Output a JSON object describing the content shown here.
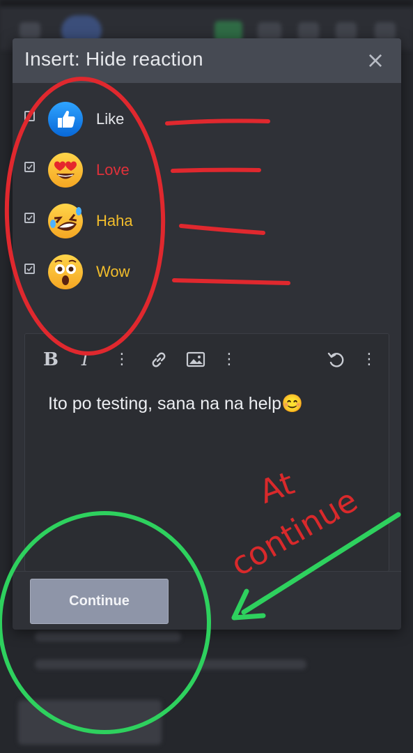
{
  "modal": {
    "title": "Insert: Hide reaction",
    "close_glyph": "×",
    "reactions": [
      {
        "label": "Like",
        "color": "#e4e6ea",
        "checked": true,
        "icon": "like-icon"
      },
      {
        "label": "Love",
        "color": "#e0313a",
        "checked": true,
        "icon": "love-icon"
      },
      {
        "label": "Haha",
        "color": "#f2bd2b",
        "checked": true,
        "icon": "haha-icon"
      },
      {
        "label": "Wow",
        "color": "#f2bd2b",
        "checked": true,
        "icon": "wow-icon"
      }
    ],
    "toolbar": {
      "bold": "B",
      "italic": "I",
      "more": "⋮"
    },
    "editor_text": "Ito po testing, sana na na help😊",
    "continue_label": "Continue"
  },
  "annotation": {
    "text_line1": "At",
    "text_line2": "continue",
    "circle_red_color": "#e0282e",
    "circle_green_color": "#2ed15e"
  }
}
